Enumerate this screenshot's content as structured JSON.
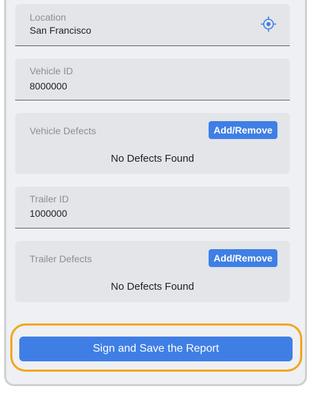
{
  "location": {
    "label": "Location",
    "value": "San Francisco",
    "icon": "crosshair-icon"
  },
  "vehicle_id": {
    "label": "Vehicle ID",
    "value": "8000000"
  },
  "vehicle_defects": {
    "title": "Vehicle Defects",
    "button_label": "Add/Remove",
    "status": "No Defects Found"
  },
  "trailer_id": {
    "label": "Trailer ID",
    "value": "1000000"
  },
  "trailer_defects": {
    "title": "Trailer Defects",
    "button_label": "Add/Remove",
    "status": "No Defects Found"
  },
  "footer": {
    "submit_label": "Sign and Save the Report"
  },
  "colors": {
    "primary": "#3f7fe5",
    "highlight": "#f2a51c",
    "field_bg": "#e3e5e8",
    "page_bg": "#eef0f3"
  }
}
